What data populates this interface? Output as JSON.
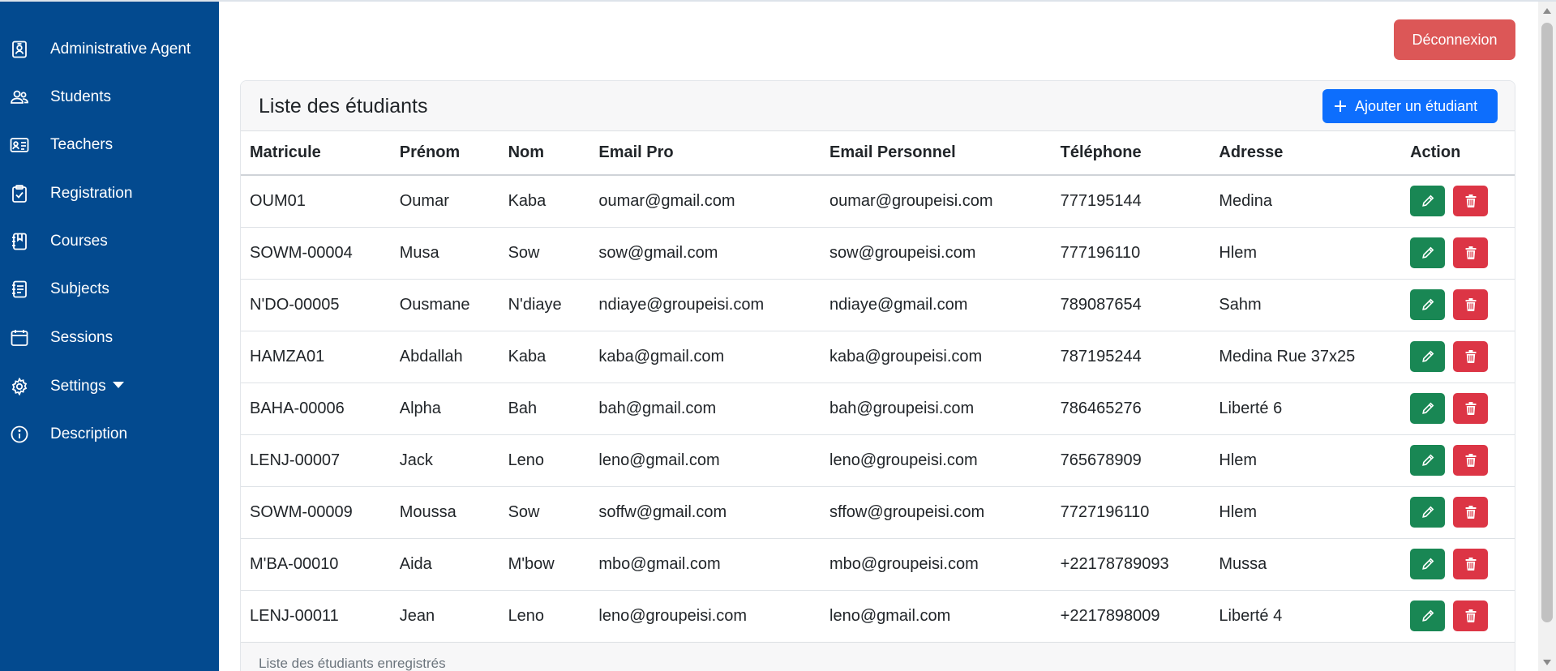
{
  "sidebar": {
    "items": [
      {
        "label": "Administrative Agent",
        "icon": "badge-icon"
      },
      {
        "label": "Students",
        "icon": "people-icon"
      },
      {
        "label": "Teachers",
        "icon": "id-card-icon"
      },
      {
        "label": "Registration",
        "icon": "clipboard-check-icon"
      },
      {
        "label": "Courses",
        "icon": "journal-bookmark-icon"
      },
      {
        "label": "Subjects",
        "icon": "journal-text-icon"
      },
      {
        "label": "Sessions",
        "icon": "calendar-icon"
      },
      {
        "label": "Settings",
        "icon": "gear-icon"
      },
      {
        "label": "Description",
        "icon": "info-circle-icon"
      }
    ]
  },
  "header": {
    "logout_label": "Déconnexion"
  },
  "card": {
    "title": "Liste des étudiants",
    "add_label": "Ajouter un étudiant",
    "footer": "Liste des étudiants enregistrés"
  },
  "table": {
    "columns": [
      "Matricule",
      "Prénom",
      "Nom",
      "Email Pro",
      "Email Personnel",
      "Téléphone",
      "Adresse",
      "Action"
    ],
    "rows": [
      [
        "OUM01",
        "Oumar",
        "Kaba",
        "oumar@gmail.com",
        "oumar@groupeisi.com",
        "777195144",
        "Medina"
      ],
      [
        "SOWM-00004",
        "Musa",
        "Sow",
        "sow@gmail.com",
        "sow@groupeisi.com",
        "777196110",
        "Hlem"
      ],
      [
        "N'DO-00005",
        "Ousmane",
        "N'diaye",
        "ndiaye@groupeisi.com",
        "ndiaye@gmail.com",
        "789087654",
        "Sahm"
      ],
      [
        "HAMZA01",
        "Abdallah",
        "Kaba",
        "kaba@gmail.com",
        "kaba@groupeisi.com",
        "787195244",
        "Medina Rue 37x25"
      ],
      [
        "BAHA-00006",
        "Alpha",
        "Bah",
        "bah@gmail.com",
        "bah@groupeisi.com",
        "786465276",
        "Liberté 6"
      ],
      [
        "LENJ-00007",
        "Jack",
        "Leno",
        "leno@gmail.com",
        "leno@groupeisi.com",
        "765678909",
        "Hlem"
      ],
      [
        "SOWM-00009",
        "Moussa",
        "Sow",
        "soffw@gmail.com",
        "sffow@groupeisi.com",
        "7727196110",
        "Hlem"
      ],
      [
        "M'BA-00010",
        "Aida",
        "M'bow",
        "mbo@gmail.com",
        "mbo@groupeisi.com",
        "+22178789093",
        "Mussa"
      ],
      [
        "LENJ-00011",
        "Jean",
        "Leno",
        "leno@groupeisi.com",
        "leno@gmail.com",
        "+2217898009",
        "Liberté 4"
      ]
    ]
  },
  "colors": {
    "sidebar": "#034a8f",
    "logout": "#dc5757",
    "primary": "#0d6efd",
    "edit": "#198754",
    "delete": "#dc3545"
  }
}
